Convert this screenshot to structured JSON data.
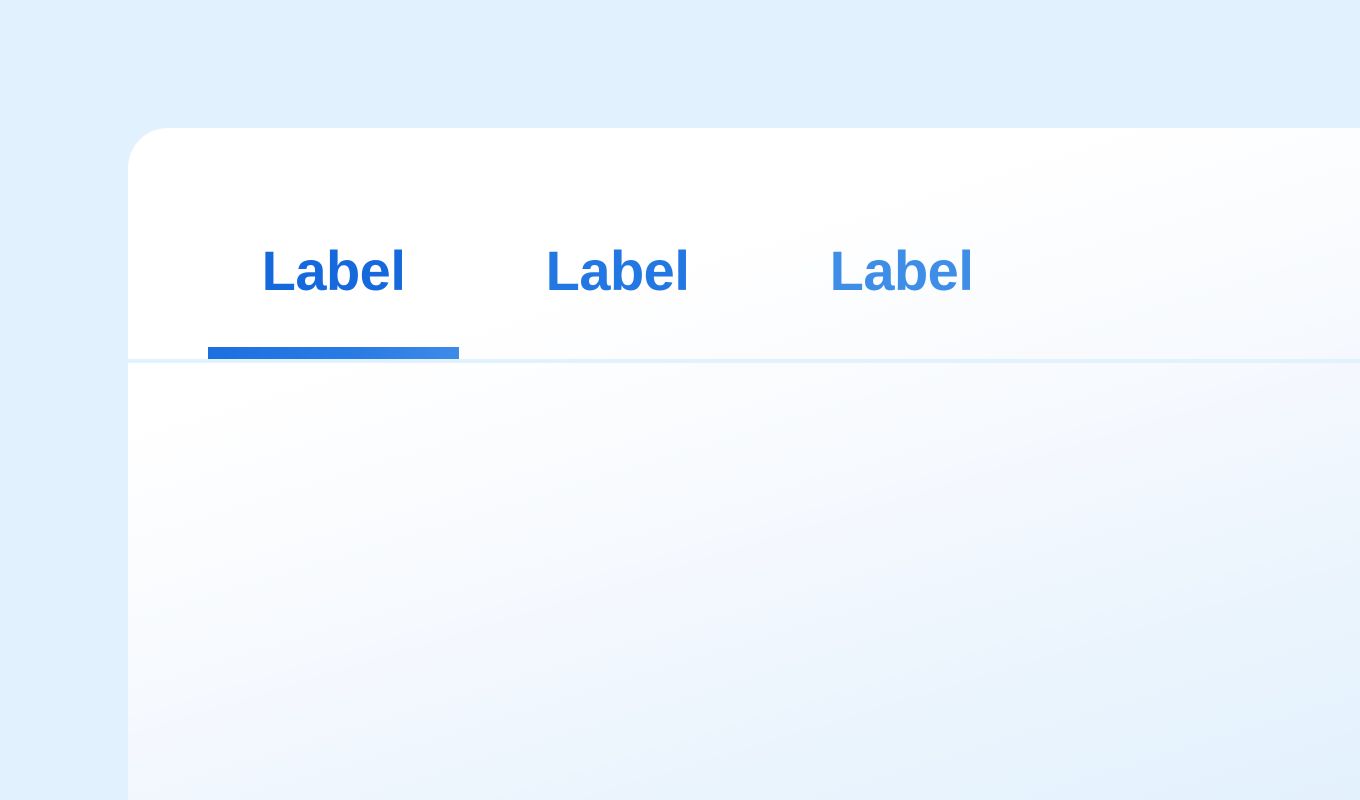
{
  "tabs": [
    {
      "label": "Label",
      "selected": true,
      "color": "#1669dc"
    },
    {
      "label": "Label",
      "selected": false,
      "color": "#2277e2"
    },
    {
      "label": "Label",
      "selected": false,
      "color": "#3e8de6"
    }
  ],
  "colors": {
    "background": "#e1f1fd",
    "card": "#ffffff",
    "indicator": "#1c6fe0",
    "divider": "#e1f1fd"
  }
}
